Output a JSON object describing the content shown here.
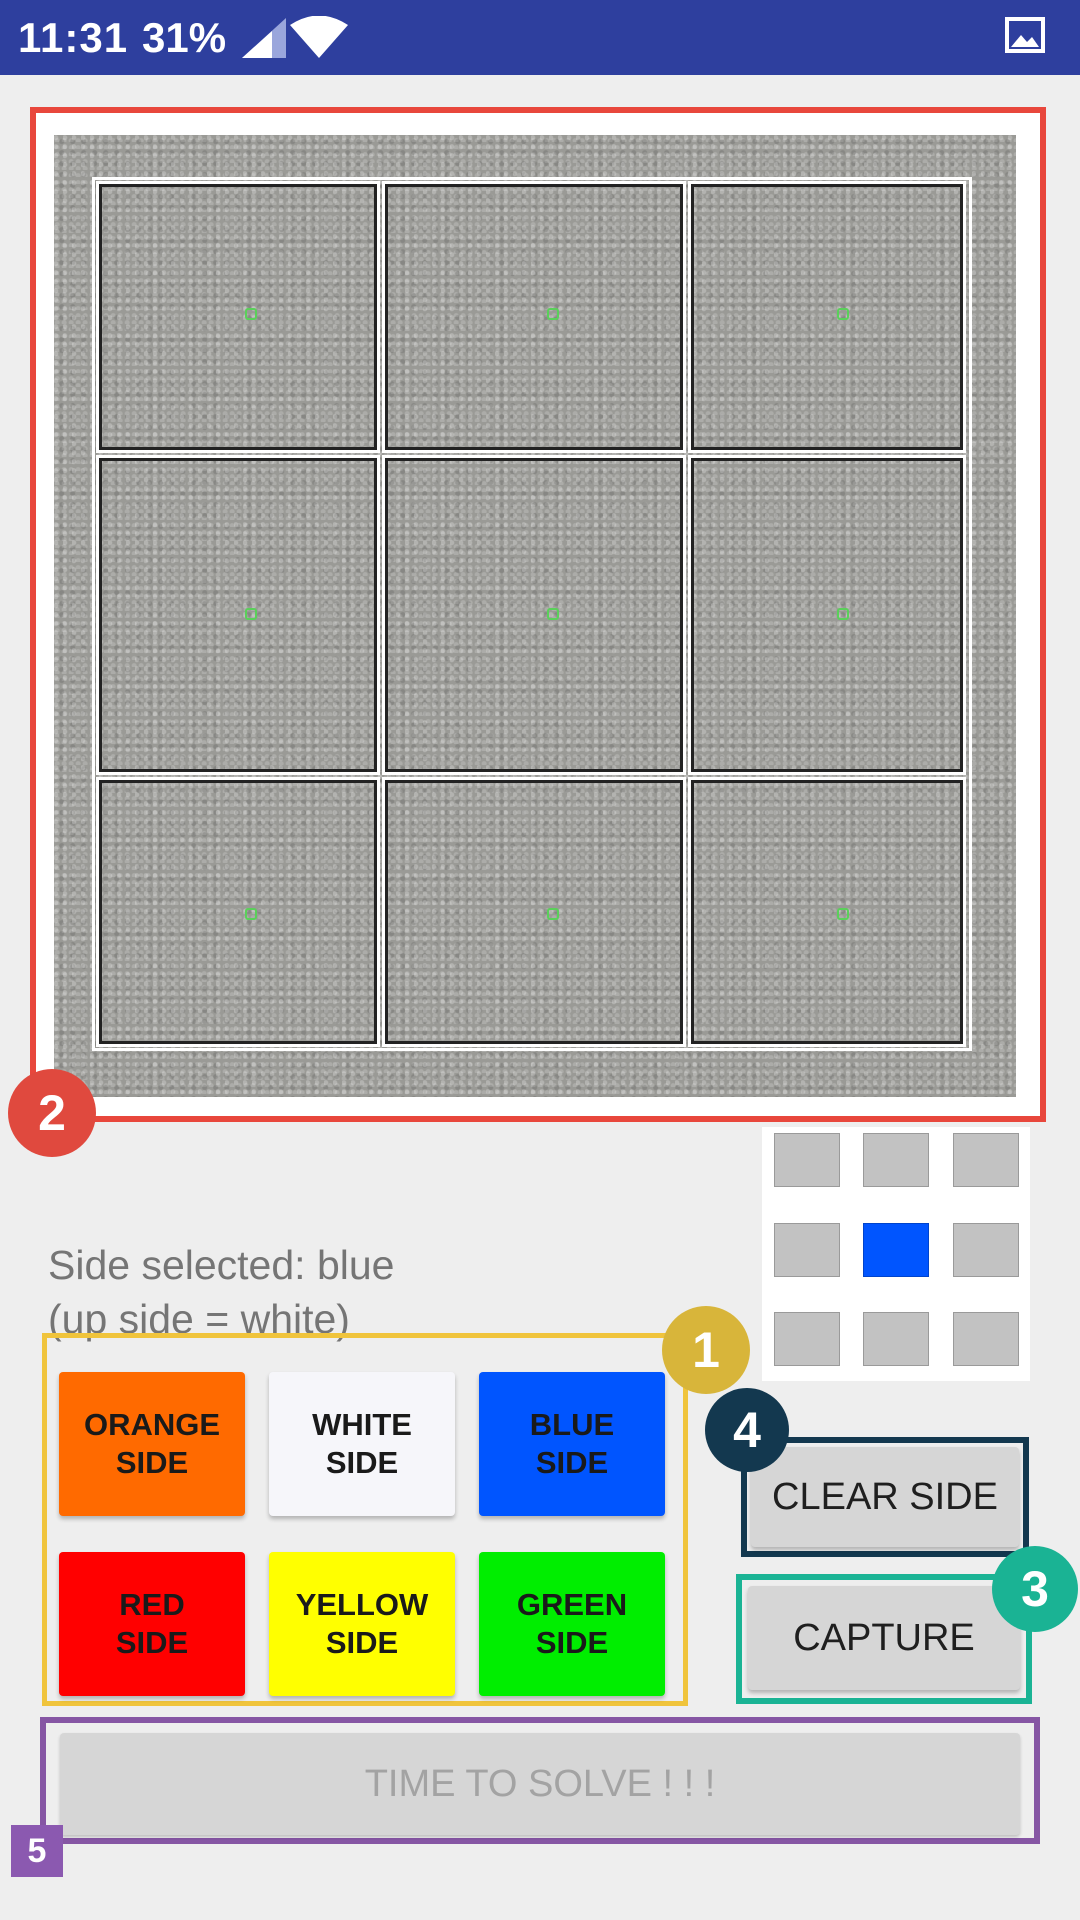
{
  "status_bar": {
    "time": "11:31",
    "battery": "31%",
    "icons": [
      "signal-icon",
      "wifi-icon",
      "gallery-icon"
    ]
  },
  "camera": {
    "grid_rows": 3,
    "grid_cols": 3
  },
  "annotations": {
    "badge_1": "1",
    "badge_2": "2",
    "badge_3": "3",
    "badge_4": "4",
    "badge_5": "5"
  },
  "side_status": {
    "line1": "Side selected: blue",
    "line2": "(up side = white)"
  },
  "mini_preview": {
    "center_color": "#0055ff",
    "default_color": "#c2c2c2"
  },
  "color_buttons": [
    {
      "line1": "ORANGE",
      "line2": "SIDE",
      "color": "#ff6a00"
    },
    {
      "line1": "WHITE",
      "line2": "SIDE",
      "color": "#f6f6fa"
    },
    {
      "line1": "BLUE",
      "line2": "SIDE",
      "color": "#0055ff"
    },
    {
      "line1": "RED",
      "line2": "SIDE",
      "color": "#ff0000"
    },
    {
      "line1": "YELLOW",
      "line2": "SIDE",
      "color": "#ffff00"
    },
    {
      "line1": "GREEN",
      "line2": "SIDE",
      "color": "#00ee00"
    }
  ],
  "actions": {
    "clear_side": "CLEAR SIDE",
    "capture": "CAPTURE",
    "solve": "TIME TO SOLVE ! ! !"
  },
  "colors": {
    "status_bar": "#2e3f9e",
    "box_red": "#e8473c",
    "box_yellow": "#f0c43c",
    "box_navy": "#13384f",
    "box_teal": "#1ab394",
    "box_purple": "#8656a4"
  }
}
